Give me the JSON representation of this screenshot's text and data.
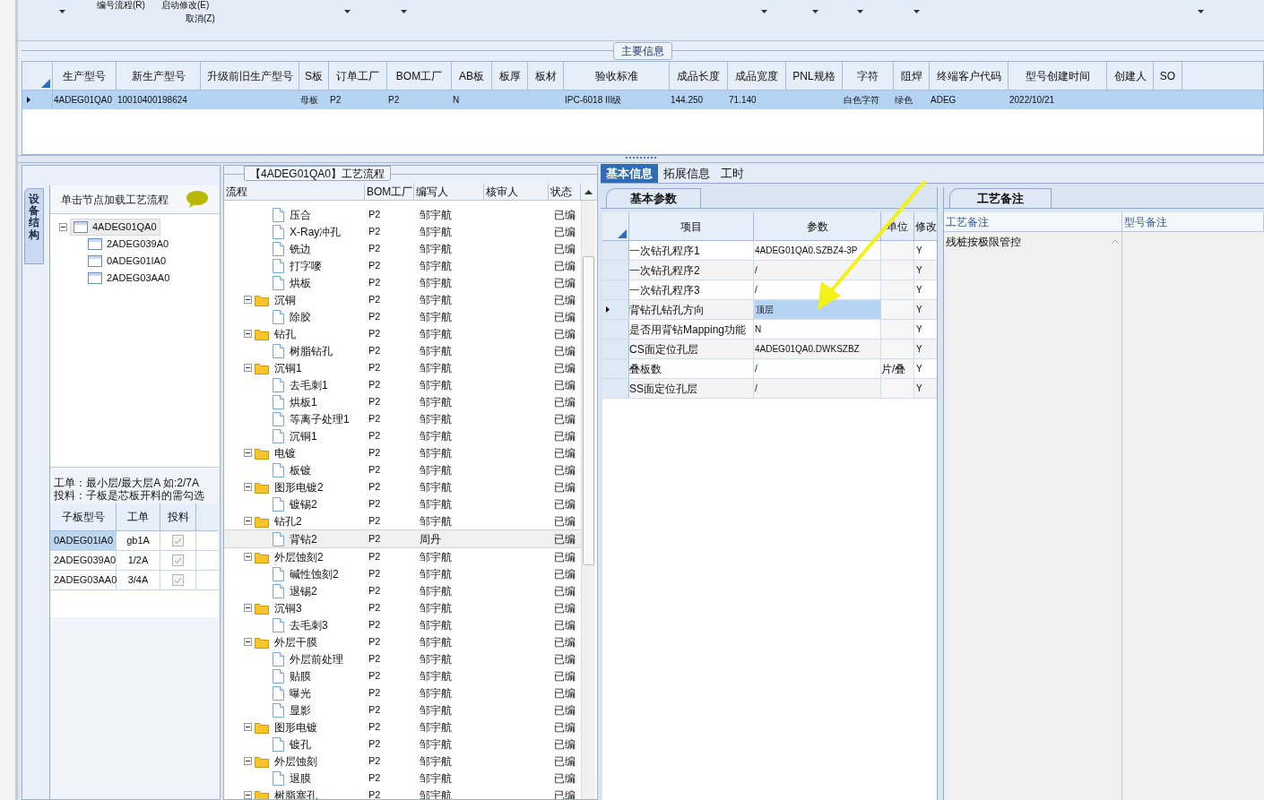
{
  "toolbar": {
    "menu_items": [
      "编号流程(R)",
      "启动修改(E)"
    ],
    "cancel": "取消(Z)"
  },
  "main_info": {
    "title": "主要信息",
    "columns": [
      "生产型号",
      "新生产型号",
      "升级前旧生产型号",
      "S板",
      "订单工厂",
      "BOM工厂",
      "AB板",
      "板厚",
      "板材",
      "验收标准",
      "成品长度",
      "成品宽度",
      "PNL规格",
      "字符",
      "阻焊",
      "终端客户代码",
      "型号创建时间",
      "创建人",
      "SO"
    ],
    "rows": [
      {
        "selected": true,
        "cells": [
          "4ADEG01QA0",
          "10010400198624",
          null,
          "母板",
          "P2",
          "P2",
          "N",
          null,
          null,
          "IPC-6018 III级",
          "144.250",
          "71.140",
          null,
          "白色字符",
          "绿色",
          "ADEG",
          "2022/10/21",
          null,
          null
        ]
      }
    ]
  },
  "structure": {
    "side_tab": "设备结构",
    "hint": "单击节点加载工艺流程",
    "tree": [
      {
        "label": "4ADEG01QA0",
        "selected": true,
        "expanded": true,
        "children": [
          {
            "label": "2ADEG039A0",
            "selected": false
          },
          {
            "label": "0ADEG01IA0",
            "selected": false
          },
          {
            "label": "2ADEG03AA0",
            "selected": false
          }
        ]
      }
    ],
    "notes": [
      "工单：最小层/最大层A 如:2/7A",
      "投料：子板是芯板开料的需勾选"
    ],
    "columns": [
      "子板型号",
      "工单",
      "投料"
    ],
    "rows": [
      {
        "model": "0ADEG01IA0",
        "order": "gb1A",
        "feed": true,
        "selected": true
      },
      {
        "model": "2ADEG039A0",
        "order": "1/2A",
        "feed": true,
        "selected": false
      },
      {
        "model": "2ADEG03AA0",
        "order": "3/4A",
        "feed": true,
        "selected": false
      }
    ]
  },
  "process": {
    "title": "【4ADEG01QA0】工艺流程",
    "columns": [
      "流程",
      "BOM工厂",
      "编写人",
      "核审人",
      "状态"
    ],
    "continued_children": [
      {
        "kind": "file",
        "name": "压合",
        "bom": "P2",
        "writer": "邹宇航",
        "status": "已编",
        "selected": false
      },
      {
        "kind": "file",
        "name": "X-Ray冲孔",
        "bom": "P2",
        "writer": "邹宇航",
        "status": "已编",
        "selected": false
      },
      {
        "kind": "file",
        "name": "铣边",
        "bom": "P2",
        "writer": "邹宇航",
        "status": "已编",
        "selected": false
      },
      {
        "kind": "file",
        "name": "打字嘜",
        "bom": "P2",
        "writer": "邹宇航",
        "status": "已编",
        "selected": false
      },
      {
        "kind": "file",
        "name": "烘板",
        "bom": "P2",
        "writer": "邹宇航",
        "status": "已编",
        "selected": false
      }
    ],
    "nodes": [
      {
        "kind": "folder",
        "name": "沉铜",
        "bom": "P2",
        "writer": "邹宇航",
        "status": "已编",
        "selected": false,
        "expanded": true,
        "children": [
          {
            "kind": "file",
            "name": "除胶",
            "bom": "P2",
            "writer": "邹宇航",
            "status": "已编",
            "selected": false
          }
        ]
      },
      {
        "kind": "folder",
        "name": "钻孔",
        "bom": "P2",
        "writer": "邹宇航",
        "status": "已编",
        "selected": false,
        "expanded": true,
        "children": [
          {
            "kind": "file",
            "name": "树脂钻孔",
            "bom": "P2",
            "writer": "邹宇航",
            "status": "已编",
            "selected": false
          }
        ]
      },
      {
        "kind": "folder",
        "name": "沉铜1",
        "bom": "P2",
        "writer": "邹宇航",
        "status": "已编",
        "selected": false,
        "expanded": true,
        "children": [
          {
            "kind": "file",
            "name": "去毛刺1",
            "bom": "P2",
            "writer": "邹宇航",
            "status": "已编",
            "selected": false
          },
          {
            "kind": "file",
            "name": "烘板1",
            "bom": "P2",
            "writer": "邹宇航",
            "status": "已编",
            "selected": false
          },
          {
            "kind": "file",
            "name": "等离子处理1",
            "bom": "P2",
            "writer": "邹宇航",
            "status": "已编",
            "selected": false
          },
          {
            "kind": "file",
            "name": "沉铜1",
            "bom": "P2",
            "writer": "邹宇航",
            "status": "已编",
            "selected": false
          }
        ]
      },
      {
        "kind": "folder",
        "name": "电镀",
        "bom": "P2",
        "writer": "邹宇航",
        "status": "已编",
        "selected": false,
        "expanded": true,
        "children": [
          {
            "kind": "file",
            "name": "板镀",
            "bom": "P2",
            "writer": "邹宇航",
            "status": "已编",
            "selected": false
          }
        ]
      },
      {
        "kind": "folder",
        "name": "图形电镀2",
        "bom": "P2",
        "writer": "邹宇航",
        "status": "已编",
        "selected": false,
        "expanded": true,
        "children": [
          {
            "kind": "file",
            "name": "镀锡2",
            "bom": "P2",
            "writer": "邹宇航",
            "status": "已编",
            "selected": false
          }
        ]
      },
      {
        "kind": "folder",
        "name": "钻孔2",
        "bom": "P2",
        "writer": "邹宇航",
        "status": "已编",
        "selected": false,
        "expanded": true,
        "children": [
          {
            "kind": "file",
            "name": "背钻2",
            "bom": "P2",
            "writer": "周丹",
            "status": "已编",
            "selected": true
          }
        ]
      },
      {
        "kind": "folder",
        "name": "外层蚀刻2",
        "bom": "P2",
        "writer": "邹宇航",
        "status": "已编",
        "selected": false,
        "expanded": true,
        "children": [
          {
            "kind": "file",
            "name": "碱性蚀刻2",
            "bom": "P2",
            "writer": "邹宇航",
            "status": "已编",
            "selected": false
          },
          {
            "kind": "file",
            "name": "退锡2",
            "bom": "P2",
            "writer": "邹宇航",
            "status": "已编",
            "selected": false
          }
        ]
      },
      {
        "kind": "folder",
        "name": "沉铜3",
        "bom": "P2",
        "writer": "邹宇航",
        "status": "已编",
        "selected": false,
        "expanded": true,
        "children": [
          {
            "kind": "file",
            "name": "去毛刺3",
            "bom": "P2",
            "writer": "邹宇航",
            "status": "已编",
            "selected": false
          }
        ]
      },
      {
        "kind": "folder",
        "name": "外层干膜",
        "bom": "P2",
        "writer": "邹宇航",
        "status": "已编",
        "selected": false,
        "expanded": true,
        "children": [
          {
            "kind": "file",
            "name": "外层前处理",
            "bom": "P2",
            "writer": "邹宇航",
            "status": "已编",
            "selected": false
          },
          {
            "kind": "file",
            "name": "贴膜",
            "bom": "P2",
            "writer": "邹宇航",
            "status": "已编",
            "selected": false
          },
          {
            "kind": "file",
            "name": "曝光",
            "bom": "P2",
            "writer": "邹宇航",
            "status": "已编",
            "selected": false
          },
          {
            "kind": "file",
            "name": "显影",
            "bom": "P2",
            "writer": "邹宇航",
            "status": "已编",
            "selected": false
          }
        ]
      },
      {
        "kind": "folder",
        "name": "图形电镀",
        "bom": "P2",
        "writer": "邹宇航",
        "status": "已编",
        "selected": false,
        "expanded": true,
        "children": [
          {
            "kind": "file",
            "name": "镀孔",
            "bom": "P2",
            "writer": "邹宇航",
            "status": "已编",
            "selected": false
          }
        ]
      },
      {
        "kind": "folder",
        "name": "外层蚀刻",
        "bom": "P2",
        "writer": "邹宇航",
        "status": "已编",
        "selected": false,
        "expanded": true,
        "children": [
          {
            "kind": "file",
            "name": "退膜",
            "bom": "P2",
            "writer": "邹宇航",
            "status": "已编",
            "selected": false
          }
        ]
      },
      {
        "kind": "folder",
        "name": "树脂塞孔",
        "bom": "P2",
        "writer": "邹宇航",
        "status": "已编",
        "selected": false,
        "expanded": true
      }
    ]
  },
  "details": {
    "tabs": [
      {
        "label": "基本信息",
        "selected": true
      },
      {
        "label": "拓展信息",
        "selected": false
      },
      {
        "label": "工时",
        "selected": false
      }
    ],
    "params": {
      "tab": "基本参数",
      "columns": [
        "项目",
        "参数",
        "单位",
        "修改"
      ],
      "rows": [
        {
          "item": "一次钻孔程序1",
          "value": "4ADEG01QA0.SZBZ4-3P",
          "modified": "Y",
          "selected": false
        },
        {
          "item": "一次钻孔程序2",
          "value": "/",
          "modified": "Y",
          "selected": false
        },
        {
          "item": "一次钻孔程序3",
          "value": "/",
          "modified": "Y",
          "selected": false
        },
        {
          "item": "背钻孔钻孔方向",
          "value": "顶层",
          "modified": "Y",
          "selected": true
        },
        {
          "item": "是否用背钻Mapping功能",
          "value": "N",
          "modified": "Y",
          "selected": false
        },
        {
          "item": "CS面定位孔层",
          "value": "4ADEG01QA0.DWKSZBZ",
          "modified": "Y",
          "selected": false
        },
        {
          "item": "叠板数",
          "value": "/",
          "unit": "片/叠",
          "modified": "Y",
          "selected": false
        },
        {
          "item": "SS面定位孔层",
          "value": "/",
          "modified": "Y",
          "selected": false
        }
      ]
    },
    "remarks": {
      "tab": "工艺备注",
      "columns": [
        "工艺备注",
        "型号备注"
      ],
      "text": "残桩按极限管控"
    }
  }
}
